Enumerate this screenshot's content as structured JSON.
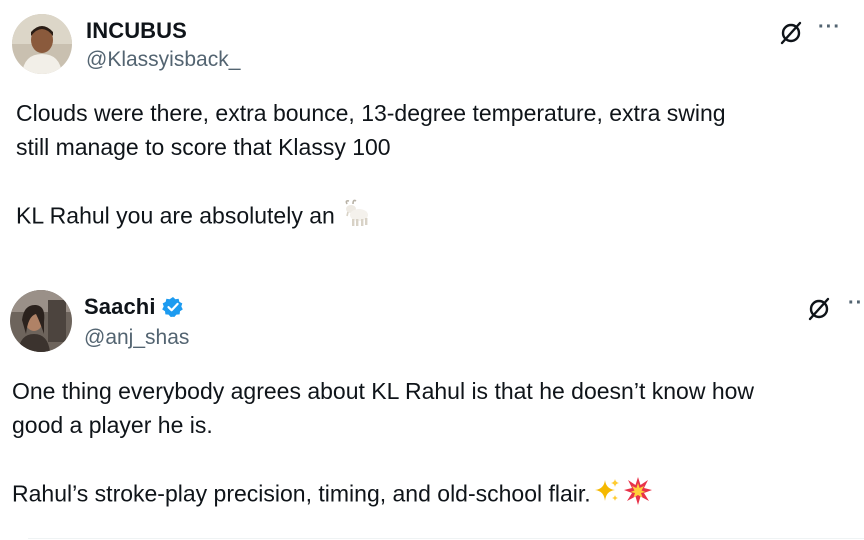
{
  "tweets": [
    {
      "display_name": "INCUBUS",
      "handle": "@Klassyisback_",
      "verified": false,
      "text_lines": [
        "Clouds were there, extra bounce, 13-degree temperature, extra swing",
        "still manage to score that Klassy 100"
      ],
      "text_line_3": "KL Rahul you are absolutely an",
      "emojis": [
        "goat"
      ],
      "more_label": "···"
    },
    {
      "display_name": "Saachi",
      "handle": "@anj_shas",
      "verified": true,
      "text_lines": [
        "One thing everybody agrees about KL Rahul is that he doesn’t know how",
        "good a player he is."
      ],
      "text_line_3": "Rahul’s stroke-play precision, timing, and old-school flair.",
      "emojis": [
        "sparkles",
        "collision"
      ],
      "more_label": "··"
    }
  ],
  "colors": {
    "text": "#0f1419",
    "secondary": "#536471",
    "verified_blue": "#1d9bf0",
    "divider": "#eff3f4"
  }
}
